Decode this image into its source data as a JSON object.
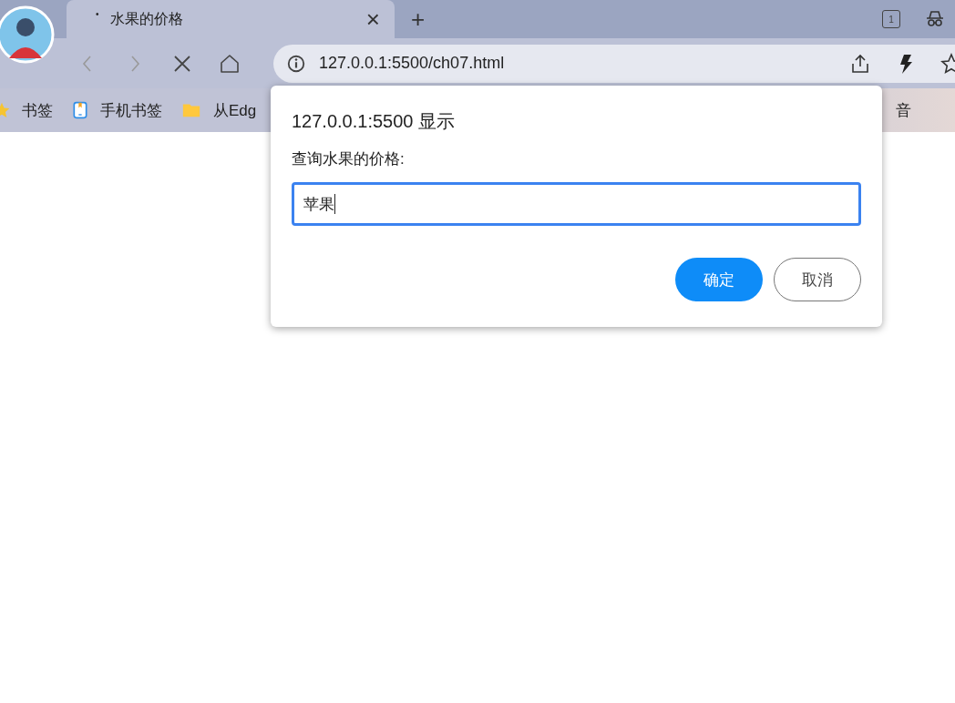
{
  "tabs": [
    {
      "title": "水果的价格",
      "loading_mark": "•",
      "close": "×",
      "selected": true
    }
  ],
  "new_tab": "+",
  "tab_count": "1",
  "address_bar": {
    "url": "127.0.0.1:5500/ch07.html"
  },
  "bookmarks": [
    {
      "label": "书签",
      "kind": "star"
    },
    {
      "label": "手机书签",
      "kind": "phone"
    },
    {
      "label": "从Edg",
      "kind": "folder"
    },
    {
      "label": "音",
      "kind": "plain"
    }
  ],
  "dialog": {
    "title": "127.0.0.1:5500 显示",
    "message": "查询水果的价格:",
    "input": {
      "value": "苹果",
      "focused": true
    },
    "buttons": [
      {
        "label": "确定",
        "kind": "primary"
      },
      {
        "label": "取消",
        "kind": "secondary"
      }
    ]
  }
}
